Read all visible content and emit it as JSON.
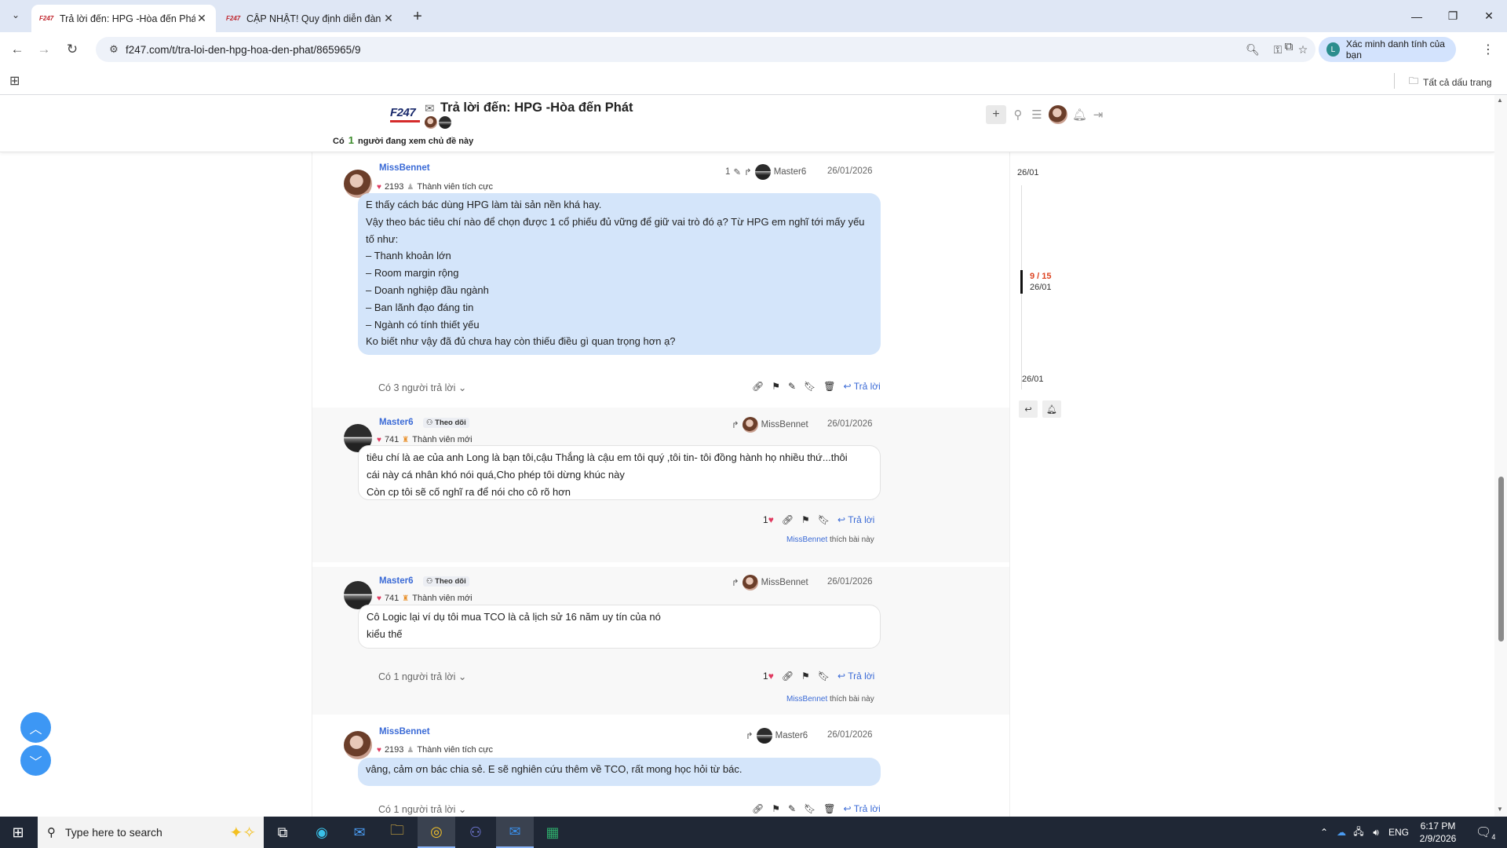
{
  "browser": {
    "tabs": [
      {
        "favicon": "F247",
        "title": "Trả lời đến: HPG -Hòa đến Phát",
        "active": true
      },
      {
        "favicon": "F247",
        "title": "CẬP NHẬT! Quy định diễn đàn",
        "active": false
      }
    ],
    "url": "f247.com/t/tra-loi-den-hpg-hoa-den-phat/865965/9",
    "verify_label": "Xác minh danh tính của bạn",
    "bookmarks_all": "Tất cả dấu trang"
  },
  "header": {
    "logo": "F247",
    "topic_title": "Trả lời đến: HPG -Hòa đến Phát",
    "viewing_prefix": "Có",
    "viewing_count": "1",
    "viewing_suffix": "người đang xem chủ đề này"
  },
  "posts": [
    {
      "author": "MissBennet",
      "likes_total": "2193",
      "rank": "Thành viên tích cực",
      "edit_count": "1",
      "reply_to": "Master6",
      "date": "26/01/2026",
      "lines": [
        "E thấy cách bác dùng HPG làm tài sản nền khá hay.",
        "Vậy theo bác tiêu chí nào để chọn được 1 cổ phiếu đủ vững để giữ vai trò đó ạ? Từ HPG em nghĩ tới mấy yếu tố như:",
        "– Thanh khoản lớn",
        "– Room margin rộng",
        "– Doanh nghiệp đầu ngành",
        "– Ban lãnh đạo đáng tin",
        "– Ngành có tính thiết yếu",
        "Ko biết như vậy đã đủ chưa hay còn thiếu điều gì quan trọng hơn ạ?"
      ],
      "reply_count": "Có 3 người trả lời",
      "reply_label": "Trả lời"
    },
    {
      "author": "Master6",
      "follow_label": "Theo dõi",
      "likes_total": "741",
      "rank": "Thành viên mới",
      "reply_to": "MissBennet",
      "date": "26/01/2026",
      "lines": [
        "tiêu chí là ae của anh Long là bạn tôi,cậu Thắng là cậu em tôi quý ,tôi tin- tôi đồng hành họ nhiều thứ...thôi",
        "cái này cá nhân khó nói quá,Cho phép tôi dừng khúc này",
        "Còn cp tôi sẽ cố nghĩ ra để nói cho cô rõ hơn"
      ],
      "like_count": "1",
      "reply_label": "Trả lời",
      "liked_by": "MissBennet",
      "liked_suffix": "thích bài này"
    },
    {
      "author": "Master6",
      "follow_label": "Theo dõi",
      "likes_total": "741",
      "rank": "Thành viên mới",
      "reply_to": "MissBennet",
      "date": "26/01/2026",
      "lines": [
        "Cô Logic lại ví dụ tôi mua TCO là cả lịch sử 16 năm uy tín của nó",
        "kiểu thế"
      ],
      "reply_count": "Có 1 người trả lời",
      "like_count": "1",
      "reply_label": "Trả lời",
      "liked_by": "MissBennet",
      "liked_suffix": "thích bài này"
    },
    {
      "author": "MissBennet",
      "likes_total": "2193",
      "rank": "Thành viên tích cực",
      "reply_to": "Master6",
      "date": "26/01/2026",
      "lines": [
        "vâng, cảm ơn bác chia sẻ. E sẽ nghiên cứu thêm về TCO, rất mong học hỏi từ bác."
      ],
      "reply_count": "Có 1 người trả lời",
      "reply_label": "Trả lời"
    }
  ],
  "timeline": {
    "top_date": "26/01",
    "position": "9 / 15",
    "current_date": "26/01",
    "bottom_date": "26/01"
  },
  "taskbar": {
    "search_placeholder": "Type here to search",
    "lang": "ENG",
    "time": "6:17 PM",
    "date": "2/9/2026",
    "notif_count": "4"
  },
  "colors": {
    "accent_blue": "#3a6ad6",
    "bubble_blue": "#d4e5fa",
    "heart_red": "#e0395f",
    "fab_blue": "#3d97f4"
  }
}
